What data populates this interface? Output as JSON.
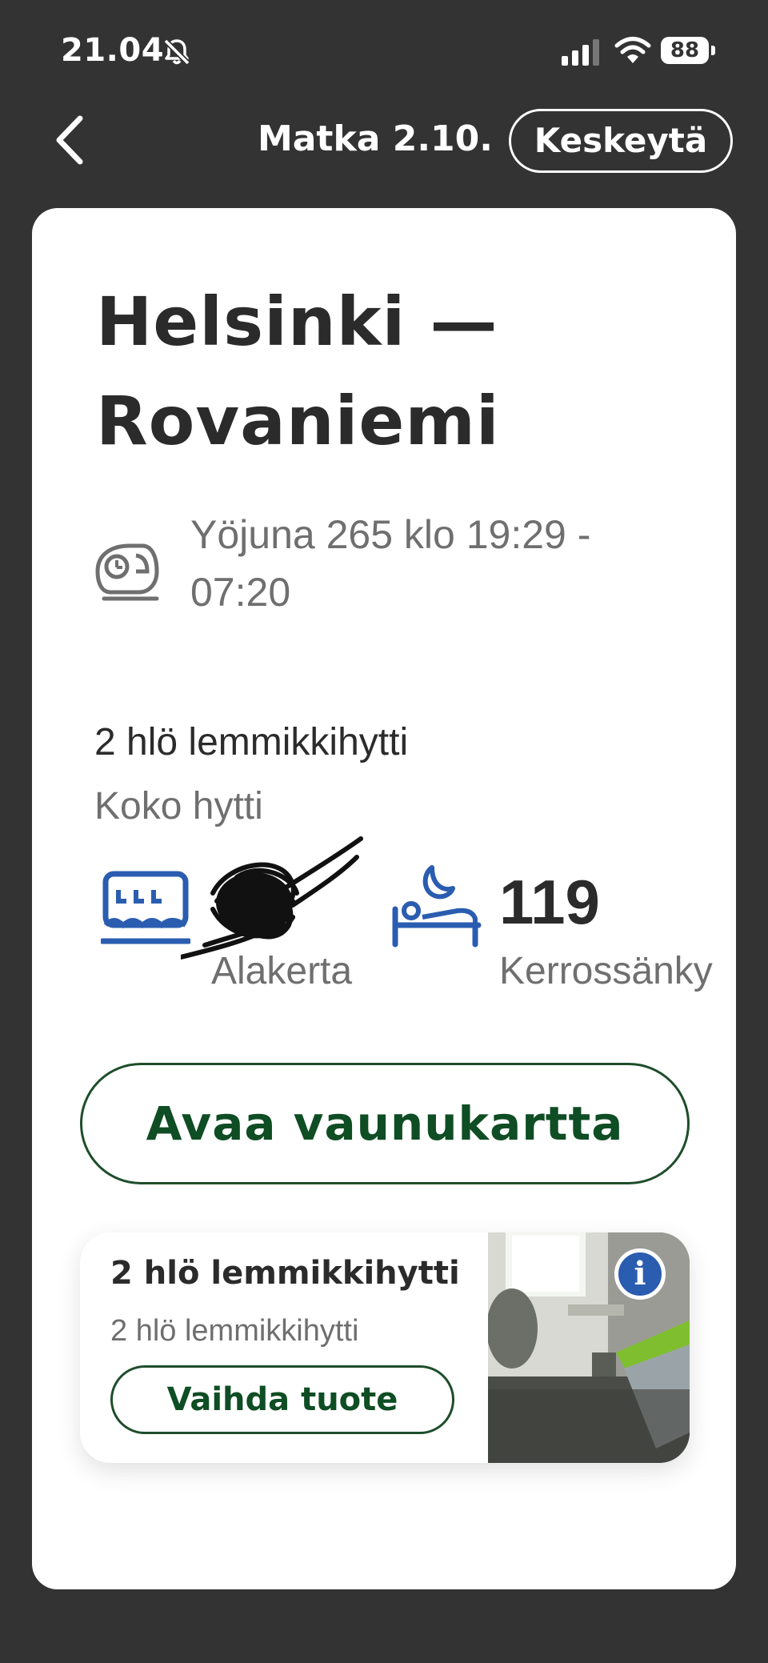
{
  "status_bar": {
    "time": "21.04",
    "battery": "88",
    "icons": [
      "bell-muted-icon",
      "signal-icon",
      "wifi-icon",
      "battery-icon"
    ]
  },
  "header": {
    "back_icon": "chevron-left-icon",
    "title": "Matka 2.10.",
    "cancel_label": "Keskeytä"
  },
  "journey": {
    "route_line1": "Helsinki —",
    "route_line2": "Rovaniemi",
    "train_icon": "train-icon",
    "train_info_line1": "Yöjuna 265 klo 19:29 -",
    "train_info_line2": "07:20"
  },
  "cabin": {
    "title": "2 hlö lemmikkihytti",
    "subtitle": "Koko hytti",
    "car_icon": "train-car-icon",
    "car_label": "Alakerta",
    "bed_icon": "bed-night-icon",
    "bed_number": "119",
    "bed_type": "Kerrossänky"
  },
  "actions": {
    "open_map_label": "Avaa vaunukartta"
  },
  "product": {
    "title": "2 hlö lemmikkihytti",
    "subtitle": "2 hlö lemmikkihytti",
    "change_label": "Vaihda tuote",
    "info_label": "i"
  },
  "colors": {
    "background": "#333333",
    "card": "#ffffff",
    "primary_green": "#0f4d24",
    "icon_blue": "#2a5db0",
    "text_dark": "#2b2b2b",
    "text_gray": "#6f6f6f"
  }
}
